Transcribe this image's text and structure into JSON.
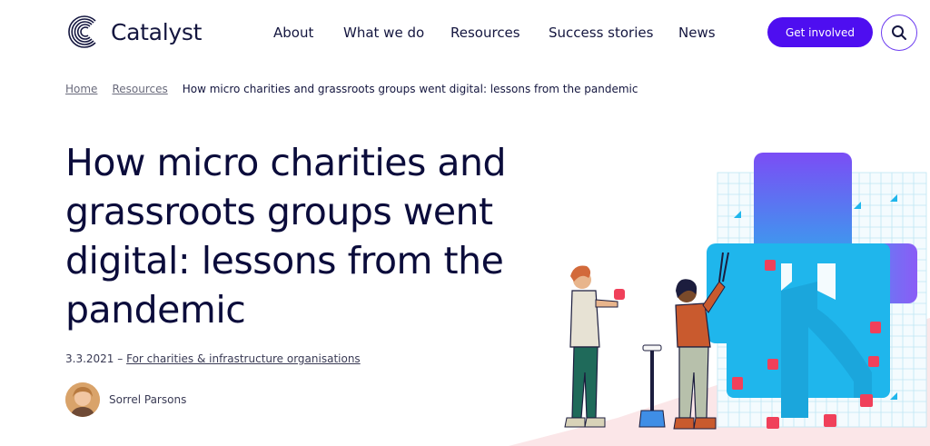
{
  "brand": {
    "name": "Catalyst"
  },
  "nav": {
    "items": [
      {
        "label": "About"
      },
      {
        "label": "What we do"
      },
      {
        "label": "Resources"
      },
      {
        "label": "Success stories"
      },
      {
        "label": "News"
      }
    ],
    "cta_label": "Get involved"
  },
  "breadcrumb": {
    "items": [
      "Home",
      "Resources"
    ],
    "current": "How micro charities and grassroots groups went digital: lessons from the pandemic"
  },
  "article": {
    "title": "How micro charities and grassroots groups went digital: lessons from the pandemic",
    "date": "3.3.2021",
    "date_separator": "–",
    "category": "For charities & infrastructure organisations",
    "author": "Sorrel Parsons"
  },
  "icons": {
    "logo": "catalyst-logo-icon",
    "search": "search-icon",
    "avatar": "author-avatar"
  },
  "colors": {
    "primary": "#4e0ef0",
    "text": "#0b0c3b",
    "tree_blue": "#1fb6ec",
    "tree_purple": "#7b4df5",
    "apple_red": "#f0405a",
    "ground_pink": "#fbe6e8"
  }
}
